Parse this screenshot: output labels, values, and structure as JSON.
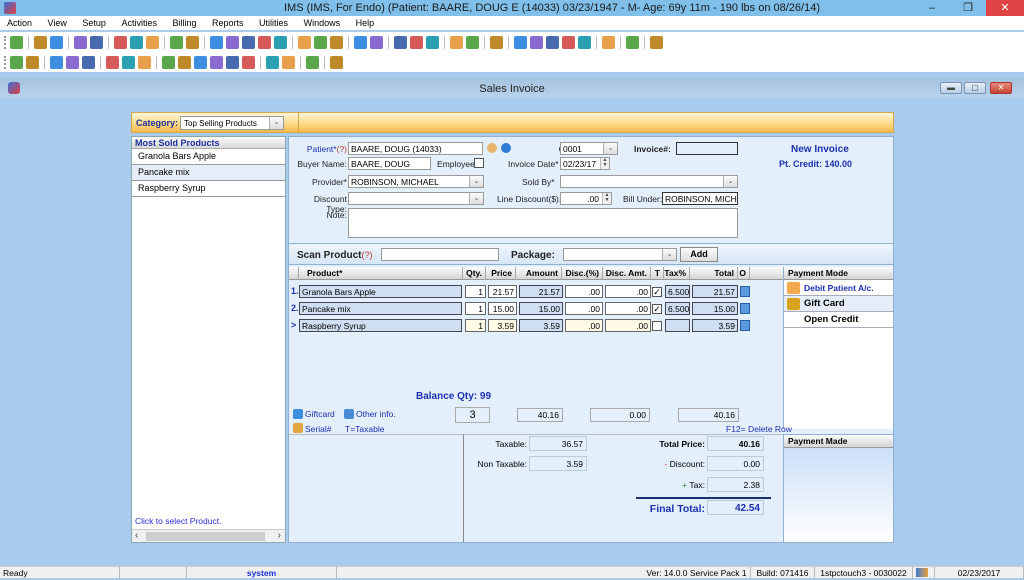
{
  "window": {
    "title": "IMS (IMS, For Endo)    (Patient: BAARE, DOUG E (14033) 03/23/1947 - M- Age: 69y 11m  - 190 lbs on 08/26/14)",
    "minimize": "–",
    "restore": "❐",
    "close": "✕"
  },
  "menu": [
    "Action",
    "View",
    "Setup",
    "Activities",
    "Billing",
    "Reports",
    "Utilities",
    "Windows",
    "Help"
  ],
  "toolbar1_icons": [
    "patient-icon",
    "provider-icon",
    "provider-check-icon",
    "folder-icon",
    "edit-chart-icon",
    "rx-icon",
    "lab-flask-icon",
    "shield-icon",
    "document-icon",
    "notes-icon",
    "dollar-icon",
    "billing-icon",
    "claims-icon",
    "payment-icon",
    "transfer-icon",
    "calendar-icon",
    "scheduler-icon",
    "letters-icon",
    "fax-icon",
    "mail-icon",
    "mail-check-icon",
    "report-icon",
    "report-edit-icon",
    "chart-icon",
    "user-folder-icon",
    "reports-icon",
    "refresh-money-icon",
    "transfer-arrows-icon",
    "word-icon",
    "template-icon",
    "print-icon",
    "help-icon",
    "lock-icon",
    "exit-icon"
  ],
  "toolbar2_icons": [
    "open-icon",
    "find-icon",
    "add-icon",
    "edit-icon",
    "delete-icon",
    "save-icon",
    "undo-icon",
    "print-icon",
    "first-icon",
    "prev-icon",
    "next-icon",
    "last-icon",
    "sort-icon",
    "preview-icon",
    "refresh-icon",
    "printer-icon",
    "help-icon",
    "close-icon"
  ],
  "child_window": {
    "title": "Sales Invoice"
  },
  "category": {
    "label": "Category:",
    "value": "Top Selling Products"
  },
  "left_pane": {
    "header": "Most Sold Products",
    "items": [
      "Granola Bars Apple",
      "Pancake mix",
      "Raspberry Syrup"
    ],
    "footer": "Click to select Product."
  },
  "form": {
    "patient_label": "Patient*",
    "help_mark": "(?)",
    "patient_value": "BAARE, DOUG  (14033)",
    "buyer_label": "Buyer Name:",
    "buyer_value": "BAARE, DOUG",
    "employee_label": "Employee:",
    "provider_label": "Provider*",
    "provider_value": "ROBINSON, MICHAEL",
    "discount_type_label": "Discount Type:",
    "discount_type_value": "",
    "note_label": "Note:",
    "note_value": "",
    "office_label": "Office:",
    "office_value": "0001",
    "invoice_label": "Invoice#:",
    "invoice_value": "",
    "invoice_date_label": "Invoice Date*",
    "invoice_date_value": "02/23/17",
    "sold_by_label": "Sold By*",
    "sold_by_value": "",
    "line_discount_label": "Line Discount($):",
    "line_discount_value": ".00",
    "bill_under_label": "Bill Under:",
    "bill_under_value": "ROBINSON, MICHAI",
    "status": "New Invoice",
    "pt_credit": "Pt. Credit: 140.00"
  },
  "scan": {
    "label": "Scan Product",
    "help_mark": "(?)",
    "value": "",
    "package_label": "Package:",
    "package_value": "",
    "add_label": "Add"
  },
  "grid": {
    "headers": [
      "Product*",
      "Qty.",
      "Price",
      "Amount",
      "Disc.(%)",
      "Disc. Amt.",
      "T",
      "Tax%",
      "Total",
      "O"
    ],
    "rows": [
      {
        "num": "1.",
        "product": "Granola Bars Apple",
        "qty": "1",
        "price": "21.57",
        "amount": "21.57",
        "disc_pct": ".00",
        "disc_amt": ".00",
        "taxable": true,
        "tax_pct": "6.500",
        "total": "21.57"
      },
      {
        "num": "2.",
        "product": "Pancake mix",
        "qty": "1",
        "price": "15.00",
        "amount": "15.00",
        "disc_pct": ".00",
        "disc_amt": ".00",
        "taxable": true,
        "tax_pct": "6.500",
        "total": "15.00"
      },
      {
        "num": ">",
        "product": "Raspberry Syrup",
        "qty": "1",
        "price": "3.59",
        "amount": "3.59",
        "disc_pct": ".00",
        "disc_amt": ".00",
        "taxable": false,
        "tax_pct": "",
        "total": "3.59"
      }
    ]
  },
  "payment_mode": {
    "header": "Payment Mode",
    "items": [
      "Debit Patient A/c.",
      "Gift Card",
      "Open Credit"
    ]
  },
  "payment_made": {
    "header": "Payment Made"
  },
  "footer_row": {
    "balance_qty": "Balance Qty: 99",
    "giftcard_link": "Giftcard",
    "other_info_link": "Other info.",
    "serial_link": "Serial#",
    "taxable_note": "T=Taxable",
    "total_qty": "3",
    "total_amount": "40.16",
    "total_discount": "0.00",
    "grand_total": "40.16",
    "delete_hint": "F12= Delete Row"
  },
  "summary": {
    "taxable_label": "Taxable:",
    "taxable_value": "36.57",
    "non_taxable_label": "Non Taxable:",
    "non_taxable_value": "3.59",
    "total_price_label": "Total Price:",
    "total_price_value": "40.16",
    "discount_sign": "-",
    "discount_label": "Discount:",
    "discount_value": "0.00",
    "tax_sign": "+",
    "tax_label": "Tax:",
    "tax_value": "2.38",
    "final_total_label": "Final Total:",
    "final_total_value": "42.54"
  },
  "statusbar": {
    "status": "Ready",
    "user": "system",
    "version": "Ver: 14.0.0 Service Pack 1",
    "build": "Build: 071416",
    "station": "1stpctouch3 - 0030022",
    "date": "02/23/2017"
  }
}
